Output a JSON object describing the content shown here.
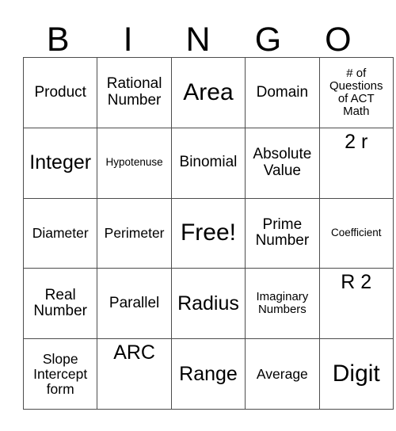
{
  "header": {
    "letters": [
      "B",
      "I",
      "N",
      "G",
      "O"
    ]
  },
  "grid": {
    "rows": [
      [
        {
          "text": "Product",
          "size": "fs-lg",
          "align": "middle"
        },
        {
          "text": "Rational\nNumber",
          "size": "fs-lg",
          "align": "middle"
        },
        {
          "text": "Area",
          "size": "fs-xxl",
          "align": "middle"
        },
        {
          "text": "Domain",
          "size": "fs-lg",
          "align": "middle"
        },
        {
          "text": "# of\nQuestions\nof ACT\nMath",
          "size": "fs-sm",
          "align": "middle"
        }
      ],
      [
        {
          "text": "Integer",
          "size": "fs-xl",
          "align": "middle"
        },
        {
          "text": "Hypotenuse",
          "size": "fs-xs",
          "align": "middle"
        },
        {
          "text": "Binomial",
          "size": "fs-lg",
          "align": "middle"
        },
        {
          "text": "Absolute\nValue",
          "size": "fs-lg",
          "align": "middle"
        },
        {
          "text": "2 r",
          "size": "fs-xl",
          "align": "top"
        }
      ],
      [
        {
          "text": "Diameter",
          "size": "fs-md",
          "align": "middle"
        },
        {
          "text": "Perimeter",
          "size": "fs-md",
          "align": "middle"
        },
        {
          "text": "Free!",
          "size": "fs-xxl",
          "align": "middle"
        },
        {
          "text": "Prime\nNumber",
          "size": "fs-lg",
          "align": "middle"
        },
        {
          "text": "Coefficient",
          "size": "fs-xs",
          "align": "middle"
        }
      ],
      [
        {
          "text": "Real\nNumber",
          "size": "fs-lg",
          "align": "middle"
        },
        {
          "text": "Parallel",
          "size": "fs-lg",
          "align": "middle"
        },
        {
          "text": "Radius",
          "size": "fs-xl",
          "align": "middle"
        },
        {
          "text": "Imaginary\nNumbers",
          "size": "fs-sm",
          "align": "middle"
        },
        {
          "text": "R 2",
          "size": "fs-xl",
          "align": "top"
        }
      ],
      [
        {
          "text": "Slope\nIntercept\nform",
          "size": "fs-md",
          "align": "middle"
        },
        {
          "text": "ARC",
          "size": "fs-xl",
          "align": "top"
        },
        {
          "text": "Range",
          "size": "fs-xl",
          "align": "middle"
        },
        {
          "text": "Average",
          "size": "fs-md",
          "align": "middle"
        },
        {
          "text": "Digit",
          "size": "fs-xxl",
          "align": "middle"
        }
      ]
    ]
  },
  "colors": {
    "background": "#ffffff",
    "text": "#000000",
    "border": "#4d4d4d"
  }
}
